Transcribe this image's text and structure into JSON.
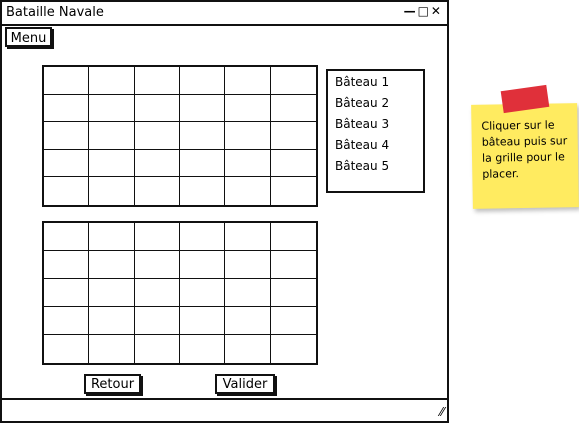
{
  "window": {
    "title": "Bataille Navale",
    "controls": "—□✕"
  },
  "menu": {
    "label": "Menu"
  },
  "boats": [
    "Bâteau 1",
    "Bâteau 2",
    "Bâteau 3",
    "Bâteau 4",
    "Bâteau 5"
  ],
  "buttons": {
    "back": "Retour",
    "validate": "Valider"
  },
  "note": {
    "text": "Cliquer sur le bâteau puis sur la grille pour le placer."
  },
  "grid": {
    "columns": 6,
    "rows": 5
  },
  "colors": {
    "note_bg": "#ffeb60",
    "tape": "#e0303a",
    "line": "#111111"
  }
}
